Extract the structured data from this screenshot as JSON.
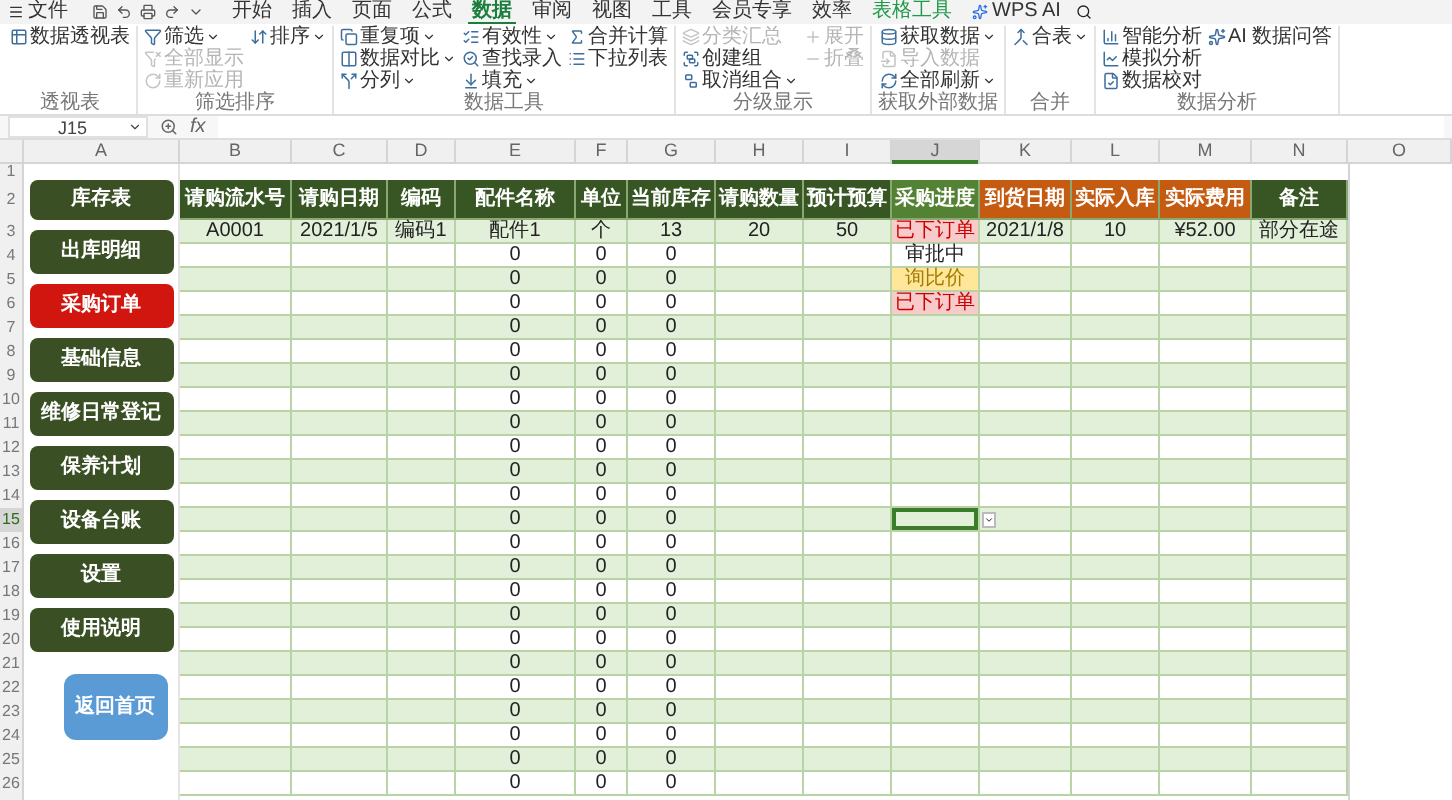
{
  "menu_bar": {
    "file": "文件",
    "tabs": [
      {
        "label": "开始",
        "kind": "tab",
        "selected": false
      },
      {
        "label": "插入",
        "kind": "tab",
        "selected": false
      },
      {
        "label": "页面",
        "kind": "tab",
        "selected": false
      },
      {
        "label": "公式",
        "kind": "tab",
        "selected": false
      },
      {
        "label": "数据",
        "kind": "tab",
        "selected": true
      },
      {
        "label": "审阅",
        "kind": "tab",
        "selected": false
      },
      {
        "label": "视图",
        "kind": "tab",
        "selected": false
      },
      {
        "label": "工具",
        "kind": "tab",
        "selected": false
      },
      {
        "label": "会员专享",
        "kind": "tab",
        "selected": false
      },
      {
        "label": "效率",
        "kind": "tab",
        "selected": false
      },
      {
        "label": "表格工具",
        "kind": "contextual",
        "selected": false
      },
      {
        "label": "WPS AI",
        "kind": "ai",
        "selected": false
      }
    ]
  },
  "ribbon": {
    "groups": [
      {
        "label": "透视表",
        "items": [
          {
            "label": "数据透视表",
            "dropdown": false,
            "disabled": false
          }
        ]
      },
      {
        "label": "筛选排序",
        "items": [
          {
            "label": "筛选",
            "dropdown": true,
            "disabled": false
          },
          {
            "label": "全部显示",
            "dropdown": false,
            "disabled": true
          },
          {
            "label": "重新应用",
            "dropdown": false,
            "disabled": true
          },
          {
            "label": "排序",
            "dropdown": true,
            "disabled": false
          }
        ]
      },
      {
        "label": "数据工具",
        "items": [
          {
            "label": "重复项",
            "dropdown": true,
            "disabled": false
          },
          {
            "label": "数据对比",
            "dropdown": true,
            "disabled": false
          },
          {
            "label": "分列",
            "dropdown": true,
            "disabled": false
          },
          {
            "label": "有效性",
            "dropdown": true,
            "disabled": false
          },
          {
            "label": "查找录入",
            "dropdown": false,
            "disabled": false
          },
          {
            "label": "填充",
            "dropdown": true,
            "disabled": false
          },
          {
            "label": "合并计算",
            "dropdown": false,
            "disabled": false
          },
          {
            "label": "下拉列表",
            "dropdown": false,
            "disabled": false
          }
        ]
      },
      {
        "label": "分级显示",
        "items": [
          {
            "label": "分类汇总",
            "dropdown": false,
            "disabled": true
          },
          {
            "label": "创建组",
            "dropdown": false,
            "disabled": false
          },
          {
            "label": "取消组合",
            "dropdown": true,
            "disabled": false
          },
          {
            "label": "展开",
            "dropdown": false,
            "disabled": true
          },
          {
            "label": "折叠",
            "dropdown": false,
            "disabled": true
          }
        ]
      },
      {
        "label": "获取外部数据",
        "items": [
          {
            "label": "获取数据",
            "dropdown": true,
            "disabled": false
          },
          {
            "label": "导入数据",
            "dropdown": false,
            "disabled": true
          },
          {
            "label": "全部刷新",
            "dropdown": true,
            "disabled": false
          }
        ]
      },
      {
        "label": "合并",
        "items": [
          {
            "label": "合表",
            "dropdown": true,
            "disabled": false
          }
        ]
      },
      {
        "label": "数据分析",
        "items": [
          {
            "label": "智能分析",
            "dropdown": false,
            "disabled": false
          },
          {
            "label": "模拟分析",
            "dropdown": false,
            "disabled": false
          },
          {
            "label": "数据校对",
            "dropdown": false,
            "disabled": false
          },
          {
            "label": "AI 数据问答",
            "dropdown": false,
            "disabled": false
          }
        ]
      }
    ]
  },
  "formula_bar": {
    "name_box": "J15",
    "fx": "fx"
  },
  "column_headers": [
    {
      "label": "A",
      "selected": false
    },
    {
      "label": "B",
      "selected": false
    },
    {
      "label": "C",
      "selected": false
    },
    {
      "label": "D",
      "selected": false
    },
    {
      "label": "E",
      "selected": false
    },
    {
      "label": "F",
      "selected": false
    },
    {
      "label": "G",
      "selected": false
    },
    {
      "label": "H",
      "selected": false
    },
    {
      "label": "I",
      "selected": false
    },
    {
      "label": "J",
      "selected": true
    },
    {
      "label": "K",
      "selected": false
    },
    {
      "label": "L",
      "selected": false
    },
    {
      "label": "M",
      "selected": false
    },
    {
      "label": "N",
      "selected": false
    },
    {
      "label": "O",
      "selected": false
    }
  ],
  "row_numbers": [
    {
      "label": "1",
      "selected": false
    },
    {
      "label": "2",
      "selected": false
    },
    {
      "label": "3",
      "selected": false
    },
    {
      "label": "4",
      "selected": false
    },
    {
      "label": "5",
      "selected": false
    },
    {
      "label": "6",
      "selected": false
    },
    {
      "label": "7",
      "selected": false
    },
    {
      "label": "8",
      "selected": false
    },
    {
      "label": "9",
      "selected": false
    },
    {
      "label": "10",
      "selected": false
    },
    {
      "label": "11",
      "selected": false
    },
    {
      "label": "12",
      "selected": false
    },
    {
      "label": "13",
      "selected": false
    },
    {
      "label": "14",
      "selected": false
    },
    {
      "label": "15",
      "selected": true
    },
    {
      "label": "16",
      "selected": false
    },
    {
      "label": "17",
      "selected": false
    },
    {
      "label": "18",
      "selected": false
    },
    {
      "label": "19",
      "selected": false
    },
    {
      "label": "20",
      "selected": false
    },
    {
      "label": "21",
      "selected": false
    },
    {
      "label": "22",
      "selected": false
    },
    {
      "label": "23",
      "selected": false
    },
    {
      "label": "24",
      "selected": false
    },
    {
      "label": "25",
      "selected": false
    },
    {
      "label": "26",
      "selected": false
    }
  ],
  "nav_buttons": [
    {
      "label": "库存表",
      "kind": "nav",
      "selected": false
    },
    {
      "label": "出库明细",
      "kind": "nav",
      "selected": false
    },
    {
      "label": "采购订单",
      "kind": "nav",
      "selected": true
    },
    {
      "label": "基础信息",
      "kind": "nav",
      "selected": false
    },
    {
      "label": "维修日常登记",
      "kind": "nav",
      "selected": false
    },
    {
      "label": "保养计划",
      "kind": "nav",
      "selected": false
    },
    {
      "label": "设备台账",
      "kind": "nav",
      "selected": false
    },
    {
      "label": "设置",
      "kind": "nav",
      "selected": false
    },
    {
      "label": "使用说明",
      "kind": "nav",
      "selected": false
    },
    {
      "label": "返回首页",
      "kind": "home",
      "selected": false
    }
  ],
  "table": {
    "headers": [
      {
        "label": "请购流水号",
        "color": "#375623"
      },
      {
        "label": "请购日期",
        "color": "#375623"
      },
      {
        "label": "编码",
        "color": "#375623"
      },
      {
        "label": "配件名称",
        "color": "#375623"
      },
      {
        "label": "单位",
        "color": "#375623"
      },
      {
        "label": "当前库存",
        "color": "#375623"
      },
      {
        "label": "请购数量",
        "color": "#375623"
      },
      {
        "label": "预计预算",
        "color": "#375623"
      },
      {
        "label": "采购进度",
        "color": "#548235"
      },
      {
        "label": "到货日期",
        "color": "#c55a11"
      },
      {
        "label": "实际入库",
        "color": "#c55a11"
      },
      {
        "label": "实际费用",
        "color": "#c55a11"
      },
      {
        "label": "备注",
        "color": "#375623"
      }
    ],
    "rows": [
      {
        "cells": {
          "B": "A0001",
          "C": "2021/1/5",
          "D": "编码1",
          "E": "配件1",
          "F": "个",
          "G": "13",
          "H": "20",
          "I": "50",
          "J": "已下订单",
          "K": "2021/1/8",
          "L": "10",
          "M": "¥52.00",
          "N": "部分在途"
        },
        "color": "#f8cbcb"
      },
      {
        "cells": {
          "E": "0",
          "F": "0",
          "G": "0",
          "J": "审批中"
        }
      },
      {
        "cells": {
          "E": "0",
          "F": "0",
          "G": "0",
          "J": "询比价"
        },
        "color": "#ffe699"
      },
      {
        "cells": {
          "E": "0",
          "F": "0",
          "G": "0",
          "J": "已下订单"
        },
        "color": "#f8cbcb"
      },
      {
        "cells": {
          "E": "0",
          "F": "0",
          "G": "0"
        }
      },
      {
        "cells": {
          "E": "0",
          "F": "0",
          "G": "0"
        }
      },
      {
        "cells": {
          "E": "0",
          "F": "0",
          "G": "0"
        }
      },
      {
        "cells": {
          "E": "0",
          "F": "0",
          "G": "0"
        }
      },
      {
        "cells": {
          "E": "0",
          "F": "0",
          "G": "0"
        }
      },
      {
        "cells": {
          "E": "0",
          "F": "0",
          "G": "0"
        }
      },
      {
        "cells": {
          "E": "0",
          "F": "0",
          "G": "0"
        }
      },
      {
        "cells": {
          "E": "0",
          "F": "0",
          "G": "0"
        }
      },
      {
        "cells": {
          "E": "0",
          "F": "0",
          "G": "0"
        }
      },
      {
        "cells": {
          "E": "0",
          "F": "0",
          "G": "0"
        }
      },
      {
        "cells": {
          "E": "0",
          "F": "0",
          "G": "0"
        }
      },
      {
        "cells": {
          "E": "0",
          "F": "0",
          "G": "0"
        }
      },
      {
        "cells": {
          "E": "0",
          "F": "0",
          "G": "0"
        }
      },
      {
        "cells": {
          "E": "0",
          "F": "0",
          "G": "0"
        }
      },
      {
        "cells": {
          "E": "0",
          "F": "0",
          "G": "0"
        }
      },
      {
        "cells": {
          "E": "0",
          "F": "0",
          "G": "0"
        }
      },
      {
        "cells": {
          "E": "0",
          "F": "0",
          "G": "0"
        }
      },
      {
        "cells": {
          "E": "0",
          "F": "0",
          "G": "0"
        }
      },
      {
        "cells": {
          "E": "0",
          "F": "0",
          "G": "0"
        }
      },
      {
        "cells": {
          "E": "0",
          "F": "0",
          "G": "0"
        }
      }
    ]
  }
}
